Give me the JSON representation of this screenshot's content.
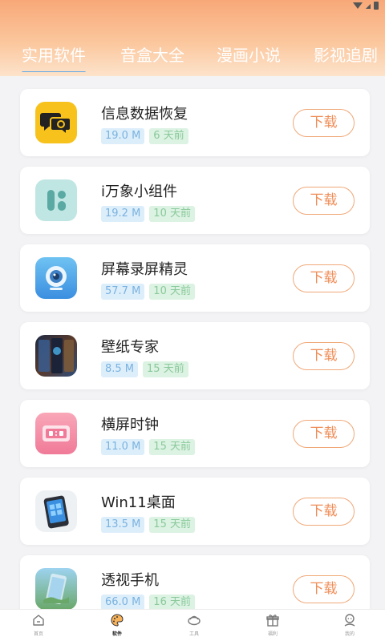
{
  "tabs": [
    {
      "label": "实用软件",
      "active": true
    },
    {
      "label": "音盒大全"
    },
    {
      "label": "漫画小说"
    },
    {
      "label": "影视追剧"
    }
  ],
  "apps": [
    {
      "name": "信息数据恢复",
      "size": "19.0 M",
      "age": "6 天前",
      "button": "下载",
      "icon": "chat-recovery-icon"
    },
    {
      "name": "i万象小组件",
      "size": "19.2 M",
      "age": "10 天前",
      "button": "下载",
      "icon": "widget-icon"
    },
    {
      "name": "屏幕录屏精灵",
      "size": "57.7 M",
      "age": "10 天前",
      "button": "下载",
      "icon": "webcam-icon"
    },
    {
      "name": "壁纸专家",
      "size": "8.5 M",
      "age": "15 天前",
      "button": "下载",
      "icon": "wallpaper-icon"
    },
    {
      "name": "横屏时钟",
      "size": "11.0 M",
      "age": "15 天前",
      "button": "下载",
      "icon": "clock-icon"
    },
    {
      "name": "Win11桌面",
      "size": "13.5 M",
      "age": "15 天前",
      "button": "下载",
      "icon": "win11-icon"
    },
    {
      "name": "透视手机",
      "size": "66.0 M",
      "age": "16 天前",
      "button": "下载",
      "icon": "xray-phone-icon"
    }
  ],
  "bottom_nav": [
    {
      "label": "首页",
      "icon": "home-icon"
    },
    {
      "label": "软件",
      "icon": "palette-icon",
      "active": true
    },
    {
      "label": "工具",
      "icon": "tools-icon"
    },
    {
      "label": "福利",
      "icon": "gift-icon"
    },
    {
      "label": "我的",
      "icon": "profile-icon"
    }
  ],
  "colors": {
    "accent": "#f08c56",
    "tab_indicator": "#5fa8e6",
    "size_badge": "#7ab2df",
    "age_badge": "#8ac99a"
  }
}
